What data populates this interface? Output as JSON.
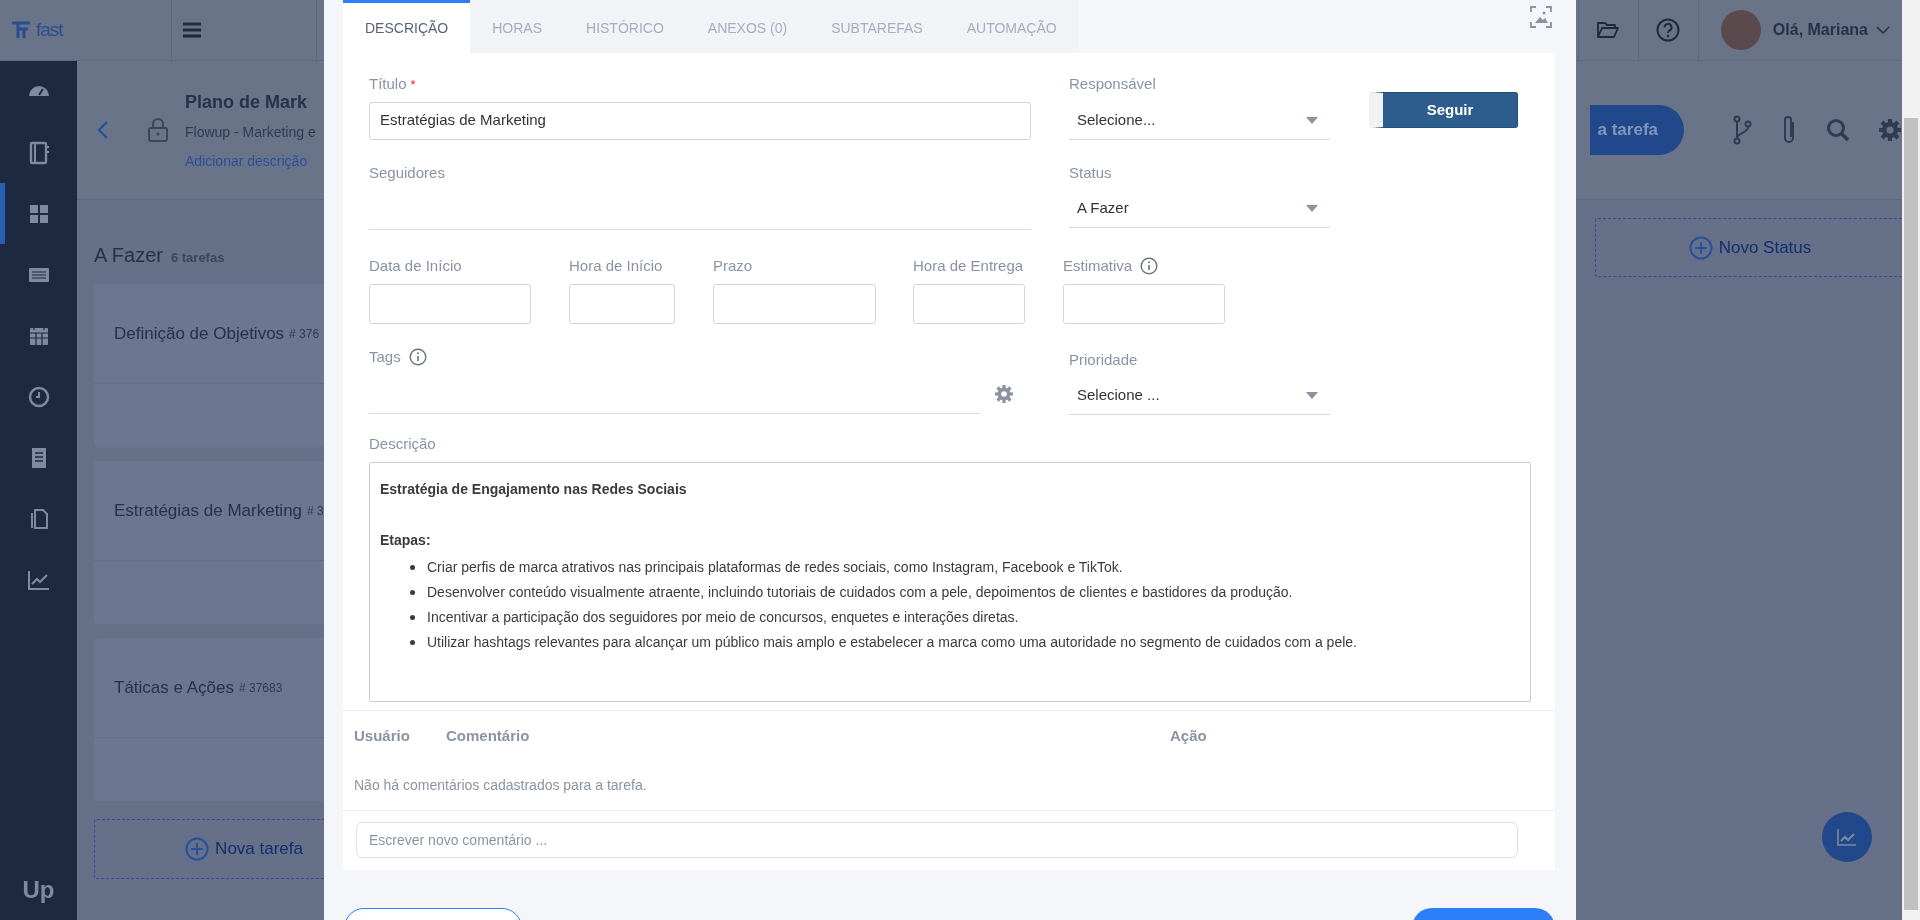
{
  "topbar": {
    "logo": "fast",
    "greeting": "Olá, Mariana"
  },
  "sidebar": {
    "items": [
      {
        "selected": false
      },
      {
        "selected": false
      },
      {
        "selected": true
      },
      {
        "selected": false
      },
      {
        "selected": false
      },
      {
        "selected": false
      },
      {
        "selected": false
      },
      {
        "selected": false
      },
      {
        "selected": false
      }
    ],
    "logo": "Up"
  },
  "project": {
    "title": "Plano de Mark",
    "subtitle": "Flowup - Marketing e",
    "add_description": "Adicionar descrição",
    "new_task_button": "a tarefa"
  },
  "board": {
    "column_title": "A Fazer",
    "count": "6 tarefas",
    "cards": [
      {
        "title": "Definição de Objetivos",
        "number": "# 376"
      },
      {
        "title": "Estratégias de Marketing",
        "number": "# 3"
      },
      {
        "title": "Táticas e Ações",
        "number": "# 37683"
      }
    ],
    "new_task": "Nova tarefa",
    "new_status": "Novo Status"
  },
  "modal": {
    "tabs": [
      {
        "label": "DESCRIÇÃO",
        "selected": true
      },
      {
        "label": "HORAS",
        "selected": false
      },
      {
        "label": "HISTÓRICO",
        "selected": false
      },
      {
        "label": "ANEXOS (0)",
        "selected": false
      },
      {
        "label": "SUBTAREFAS",
        "selected": false
      },
      {
        "label": "AUTOMAÇÃO",
        "selected": false
      }
    ],
    "title_label": "Título",
    "required_mark": "*",
    "title_value": "Estratégias de Marketing",
    "followers_label": "Seguidores",
    "responsible": {
      "label": "Responsável",
      "value": "Selecione..."
    },
    "follow_button": "Seguir",
    "status": {
      "label": "Status",
      "value": "A Fazer"
    },
    "date_fields": [
      {
        "label": "Data de Início"
      },
      {
        "label": "Hora de Início"
      },
      {
        "label": "Prazo"
      },
      {
        "label": "Hora de Entrega"
      },
      {
        "label": "Estimativa",
        "info": true
      }
    ],
    "tags_label": "Tags",
    "priority": {
      "label": "Prioridade",
      "value": "Selecione ..."
    },
    "description": {
      "label": "Descrição",
      "heading": "Estratégia de Engajamento nas Redes Sociais",
      "subheading": "Etapas:",
      "items": [
        "Criar perfis de marca atrativos nas principais plataformas de redes sociais, como Instagram, Facebook e TikTok.",
        "Desenvolver conteúdo visualmente atraente, incluindo tutoriais de cuidados com a pele, depoimentos de clientes e bastidores da produção.",
        "Incentivar a participação dos seguidores por meio de concursos, enquetes e interações diretas.",
        "Utilizar hashtags relevantes para alcançar um público mais amplo e estabelecer a marca como uma autoridade no segmento de cuidados com a pele."
      ]
    },
    "comments": {
      "columns": [
        "Usuário",
        "Comentário",
        "Ação"
      ],
      "empty": "Não há comentários cadastrados para a tarefa.",
      "placeholder": "Escrever novo comentário ..."
    }
  }
}
